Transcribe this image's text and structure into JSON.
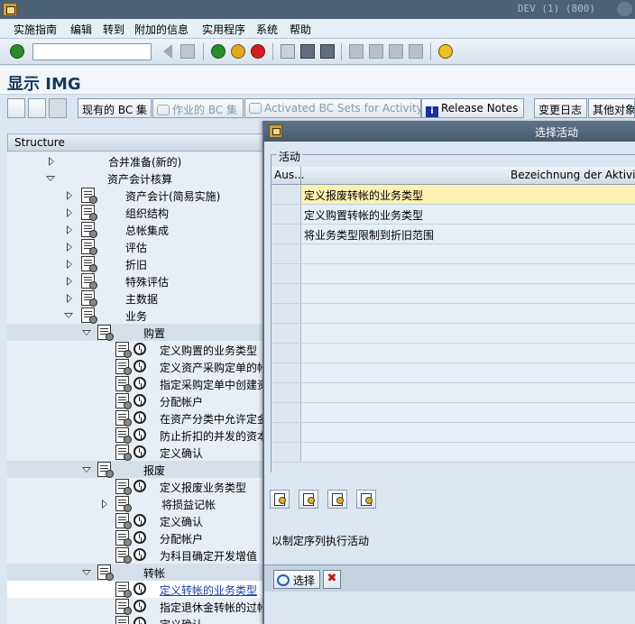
{
  "window": {
    "system_id": "DEV (1) (800)"
  },
  "menu": [
    "实施指南",
    "编辑",
    "转到",
    "附加的信息",
    "实用程序",
    "系统",
    "帮助"
  ],
  "command_field": {
    "value": ""
  },
  "page": {
    "title": "显示 IMG"
  },
  "app_toolbar": {
    "existing_bc_sets": "现有的 BC 集",
    "working_bc_sets": "作业的 BC 集",
    "activated_bc_sets": "Activated BC Sets for Activity",
    "release_notes": "Release Notes",
    "change_log": "变更日志",
    "other_objects": "其他对象"
  },
  "tree": {
    "header": "Structure",
    "items": [
      {
        "label": "合并准备(新的)"
      },
      {
        "label": "资产会计核算"
      },
      {
        "label": "资产会计(简易实施)"
      },
      {
        "label": "组织结构"
      },
      {
        "label": "总帐集成"
      },
      {
        "label": "评估"
      },
      {
        "label": "折旧"
      },
      {
        "label": "特殊评估"
      },
      {
        "label": "主数据"
      },
      {
        "label": "业务"
      },
      {
        "label": "购置"
      },
      {
        "label": "定义购置的业务类型"
      },
      {
        "label": "定义资产采购定单的帐"
      },
      {
        "label": "指定采购定单中创建资"
      },
      {
        "label": "分配帐户"
      },
      {
        "label": "在资产分类中允许定金"
      },
      {
        "label": "防止折扣的并发的资本"
      },
      {
        "label": "定义确认"
      },
      {
        "label": "报废"
      },
      {
        "label": "定义报废业务类型"
      },
      {
        "label": "将损益记帐"
      },
      {
        "label": "定义确认"
      },
      {
        "label": "分配帐户"
      },
      {
        "label": "为科目确定开发增值"
      },
      {
        "label": "转帐"
      },
      {
        "label": "定义转帐的业务类型"
      },
      {
        "label": "指定退休金转帐的过帐变量"
      },
      {
        "label": "定义确认"
      }
    ]
  },
  "dialog": {
    "title": "选择活动",
    "group_label": "活动",
    "columns": {
      "a": "Aus...",
      "b": "Bezeichnung der Aktivitä"
    },
    "rows": [
      "定义报废转帐的业务类型",
      "定义购置转帐的业务类型",
      "将业务类型限制到折旧范围"
    ],
    "status_text": "以制定序列执行活动",
    "choose_label": "选择"
  },
  "colors": {
    "title_bar": "#4c6078",
    "highlight_row": "#fdf0b0",
    "link": "#1a3fa8"
  }
}
